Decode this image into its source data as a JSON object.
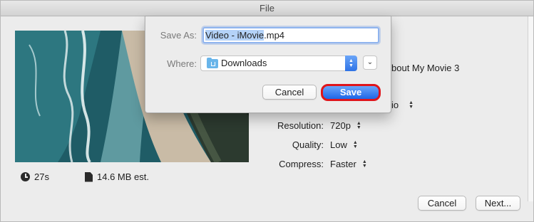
{
  "window": {
    "title": "File"
  },
  "info": {
    "duration": "27s",
    "size": "14.6 MB est."
  },
  "partial_texts": {
    "title_fragment": "bout My Movie 3",
    "format_fragment": "io"
  },
  "settings": [
    {
      "label": "Resolution:",
      "value": "720p"
    },
    {
      "label": "Quality:",
      "value": "Low"
    },
    {
      "label": "Compress:",
      "value": "Faster"
    }
  ],
  "footer": {
    "cancel_label": "Cancel",
    "next_label": "Next..."
  },
  "save_sheet": {
    "save_as_label": "Save As:",
    "filename_selected": "Video - iMovie",
    "filename_ext": ".mp4",
    "where_label": "Where:",
    "where_value": "Downloads",
    "cancel_label": "Cancel",
    "save_label": "Save"
  },
  "colors": {
    "accent": "#2f73e6",
    "highlight_ring": "#e0151b",
    "selection": "#b4d2f8"
  }
}
